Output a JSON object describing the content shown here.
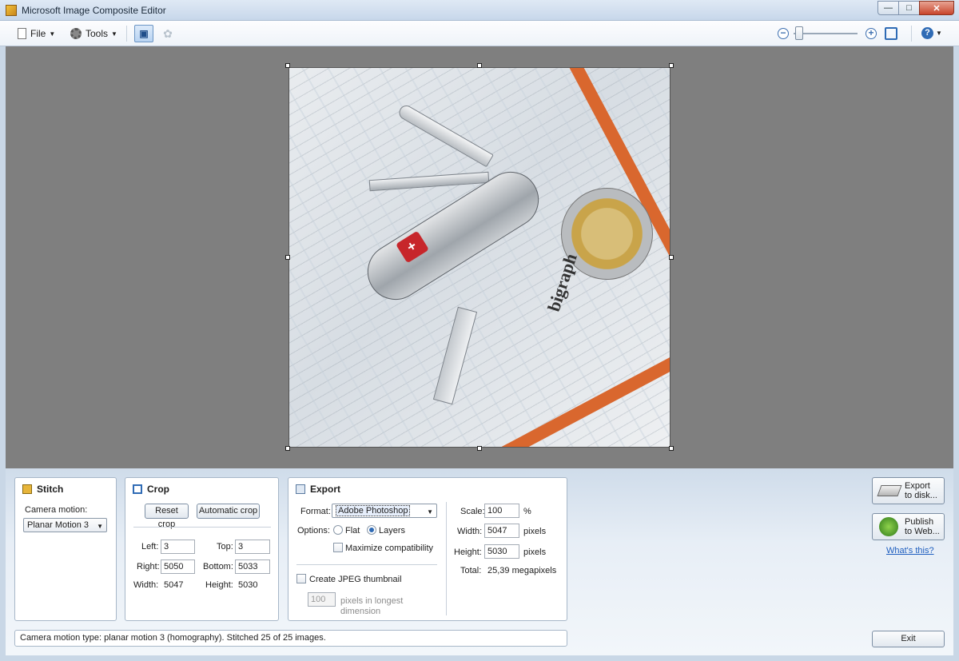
{
  "window": {
    "title": "Microsoft Image Composite Editor"
  },
  "toolbar": {
    "file_label": "File",
    "tools_label": "Tools"
  },
  "stitch": {
    "title": "Stitch",
    "camera_motion_label": "Camera motion:",
    "camera_motion_value": "Planar Motion 3"
  },
  "crop": {
    "title": "Crop",
    "reset_label": "Reset crop",
    "auto_label": "Automatic crop",
    "left_label": "Left:",
    "left_value": "3",
    "top_label": "Top:",
    "top_value": "3",
    "right_label": "Right:",
    "right_value": "5050",
    "bottom_label": "Bottom:",
    "bottom_value": "5033",
    "width_label": "Width:",
    "width_value": "5047",
    "height_label": "Height:",
    "height_value": "5030"
  },
  "export": {
    "title": "Export",
    "format_label": "Format:",
    "format_value": "Adobe Photoshop",
    "options_label": "Options:",
    "flat_label": "Flat",
    "layers_label": "Layers",
    "maximize_label": "Maximize compatibility",
    "jpeg_thumb_label": "Create JPEG thumbnail",
    "thumb_value": "100",
    "thumb_unit_line1": "pixels in longest",
    "thumb_unit_line2": "dimension",
    "scale_label": "Scale:",
    "scale_value": "100",
    "scale_unit": "%",
    "width_label": "Width:",
    "width_value": "5047",
    "width_unit": "pixels",
    "height_label": "Height:",
    "height_value": "5030",
    "height_unit": "pixels",
    "total_label": "Total:",
    "total_value": "25,39 megapixels"
  },
  "side": {
    "export_line1": "Export",
    "export_line2": "to disk...",
    "publish_line1": "Publish",
    "publish_line2": "to Web...",
    "whats_this": "What's this?",
    "exit_label": "Exit"
  },
  "status": {
    "text": "Camera motion type: planar motion 3 (homography). Stitched 25 of 25 images."
  },
  "photo": {
    "brand_text": "bigraph"
  }
}
